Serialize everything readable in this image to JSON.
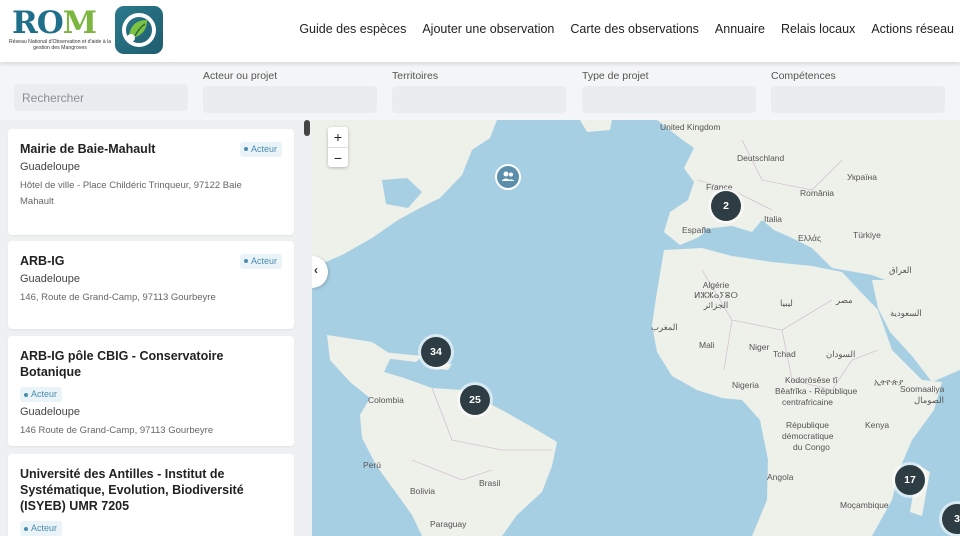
{
  "header": {
    "logo_text_1": "RO",
    "logo_text_2": "M",
    "logo_subtitle": "Réseau National d'Observation et d'aide à la gestion des Mangroves",
    "nav": [
      {
        "label": "Guide des espèces"
      },
      {
        "label": "Ajouter une observation"
      },
      {
        "label": "Carte des observations"
      },
      {
        "label": "Annuaire"
      },
      {
        "label": "Relais locaux"
      },
      {
        "label": "Actions réseau"
      }
    ]
  },
  "filters": {
    "search_placeholder": "Rechercher",
    "fields": [
      {
        "label": "Acteur ou projet"
      },
      {
        "label": "Territoires"
      },
      {
        "label": "Type de projet"
      },
      {
        "label": "Compétences"
      }
    ]
  },
  "list": {
    "cards": [
      {
        "title": "Mairie de Baie-Mahault",
        "badge": "Acteur",
        "region": "Guadeloupe",
        "address": "Hôtel de ville - Place Childéric Trinqueur, 97122 Baie Mahault"
      },
      {
        "title": "ARB-IG",
        "badge": "Acteur",
        "region": "Guadeloupe",
        "address": "146, Route de Grand-Camp, 97113 Gourbeyre"
      },
      {
        "title": "ARB-IG pôle CBIG - Conservatoire Botanique",
        "badge": "Acteur",
        "region": "Guadeloupe",
        "address": "146 Route de Grand-Camp, 97113 Gourbeyre"
      },
      {
        "title": "Université des Antilles - Institut de Systématique, Evolution, Biodiversité (ISYEB) UMR 7205",
        "badge": "Acteur",
        "region": "",
        "address": ""
      }
    ]
  },
  "map": {
    "zoom_in": "+",
    "zoom_out": "−",
    "collapse": "‹",
    "clusters": [
      {
        "count": "2"
      },
      {
        "count": "34"
      },
      {
        "count": "25"
      },
      {
        "count": "17"
      },
      {
        "count": "3"
      }
    ],
    "labels": {
      "uk": "United Kingdom",
      "deutschland": "Deutschland",
      "france": "France",
      "romania": "România",
      "ukraine": "Україна",
      "espana": "España",
      "italia": "Italia",
      "ellada": "Ελλάς",
      "turkiye": "Türkiye",
      "iraq": "العراق",
      "algerie": "Algérie\nⵍⵣⵣⴰⵢⴻⵔ\nالجزائر",
      "libya": "ليبيا",
      "egypt": "مصر",
      "saudi": "السعودية",
      "morocco": "المغرب",
      "mali": "Mali",
      "niger": "Niger",
      "tchad": "Tchad",
      "sudan": "السودان",
      "nigeria": "Nigeria",
      "ethiopia": "ኢትዮጵያ",
      "kodorosese": "Kodorösêse tî",
      "bafrika": "Bêafrîka - République",
      "centrafricaine": "centrafricaine",
      "somaliya": "Soomaaliya",
      "somaliya2": "الصومال",
      "kenya": "Kenya",
      "rdc1": "République",
      "rdc2": "démocratique",
      "rdc3": "du Congo",
      "angola": "Angola",
      "mocambique": "Moçambique",
      "colombia": "Colombia",
      "peru": "Perú",
      "brasil": "Brasil",
      "bolivia": "Bolivia",
      "paraguay": "Paraguay"
    }
  }
}
